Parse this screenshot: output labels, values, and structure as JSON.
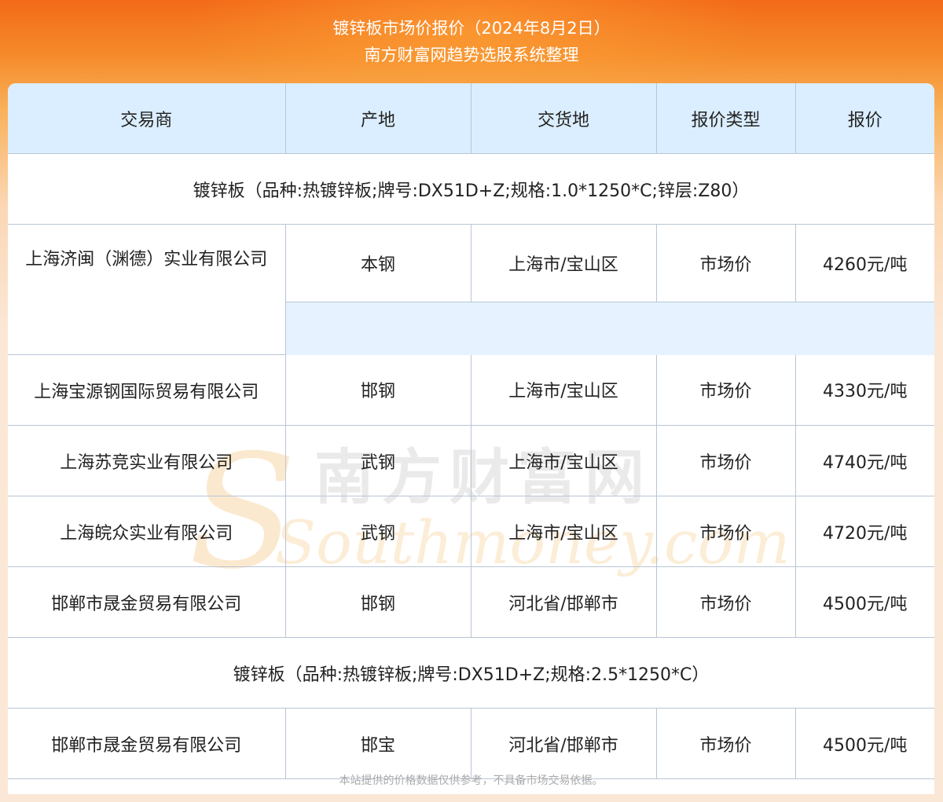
{
  "header": {
    "title": "镀锌板市场价报价（2024年8月2日）",
    "subtitle": "南方财富网趋势选股系统整理"
  },
  "table": {
    "columns": [
      "交易商",
      "产地",
      "交货地",
      "报价类型",
      "报价"
    ],
    "groups": [
      {
        "label": "镀锌板（品种:热镀锌板;牌号:DX51D+Z;规格:1.0*1250*C;锌层:Z80）",
        "rows": [
          [
            "上海济闽（渊德）实业有限公司",
            "本钢",
            "上海市/宝山区",
            "市场价",
            "4260元/吨"
          ],
          [
            "上海宝源钢国际贸易有限公司",
            "邯钢",
            "上海市/宝山区",
            "市场价",
            "4330元/吨"
          ],
          [
            "上海苏竞实业有限公司",
            "武钢",
            "上海市/宝山区",
            "市场价",
            "4740元/吨"
          ],
          [
            "上海皖众实业有限公司",
            "武钢",
            "上海市/宝山区",
            "市场价",
            "4720元/吨"
          ],
          [
            "邯郸市晟金贸易有限公司",
            "邯钢",
            "河北省/邯郸市",
            "市场价",
            "4500元/吨"
          ]
        ]
      },
      {
        "label": "镀锌板（品种:热镀锌板;牌号:DX51D+Z;规格:2.5*1250*C）",
        "rows": [
          [
            "邯郸市晟金贸易有限公司",
            "邯宝",
            "河北省/邯郸市",
            "市场价",
            "4500元/吨"
          ]
        ]
      }
    ]
  },
  "watermark": {
    "chinese": "南方财富网",
    "english": "Southmoney.com"
  },
  "footnote": "本站提供的价格数据仅供参考，不具备市场交易依据。"
}
